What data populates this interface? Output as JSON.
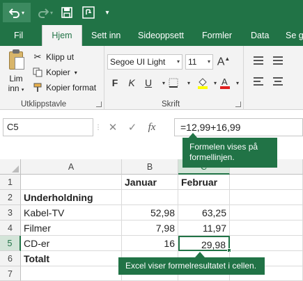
{
  "qat": {
    "undo_icon": "undo-icon",
    "redo_icon": "redo-icon",
    "save_icon": "save-icon",
    "touch_icon": "touch-mode-icon",
    "more_icon": "customize-qat-icon"
  },
  "tabs": [
    "Fil",
    "Hjem",
    "Sett inn",
    "Sideoppsett",
    "Formler",
    "Data",
    "Se gj"
  ],
  "ribbon": {
    "paste_label": "Lim",
    "paste_sub": "inn",
    "cut": "Klipp ut",
    "copy": "Kopier",
    "format_painter": "Kopier format",
    "clipboard_group": "Utklippstavle",
    "font_name": "Segoe UI Light",
    "font_size": "11",
    "bold": "F",
    "italic": "K",
    "underline": "U",
    "font_group": "Skrift",
    "colors": {
      "brand": "#217346",
      "highlight": "#ffff00",
      "font_color": "#e02020"
    }
  },
  "formula_bar": {
    "name_box": "C5",
    "cancel": "✕",
    "enter": "✓",
    "fx": "fx",
    "formula": "=12,99+16,99"
  },
  "callouts": {
    "formula_bar_note": "Formelen vises på formellinjen.",
    "cell_note": "Excel viser formelresultatet i cellen."
  },
  "sheet": {
    "columns": [
      "A",
      "B",
      "C"
    ],
    "rows": [
      {
        "num": "1",
        "a": "",
        "b": "Januar",
        "c": "Februar"
      },
      {
        "num": "2",
        "a": "Underholdning",
        "b": "",
        "c": ""
      },
      {
        "num": "3",
        "a": "Kabel-TV",
        "b": "52,98",
        "c": "63,25"
      },
      {
        "num": "4",
        "a": "Filmer",
        "b": "7,98",
        "c": "11,97"
      },
      {
        "num": "5",
        "a": "CD-er",
        "b": "16",
        "c": "29,98"
      },
      {
        "num": "6",
        "a": "Totalt",
        "b": "",
        "c": ""
      },
      {
        "num": "7",
        "a": "",
        "b": "",
        "c": ""
      }
    ]
  }
}
